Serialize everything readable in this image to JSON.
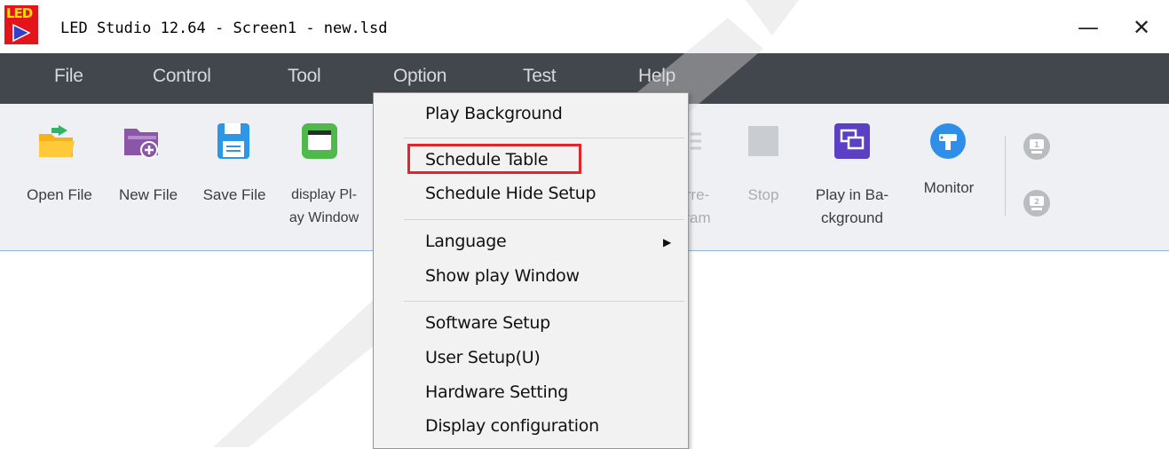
{
  "window": {
    "icon_text": "LED",
    "title": "LED Studio 12.64 - Screen1 - new.lsd",
    "minimize_glyph": "—",
    "close_glyph": "✕"
  },
  "menubar": {
    "items": [
      "File",
      "Control",
      "Tool",
      "Option",
      "Test",
      "Help"
    ]
  },
  "toolbar": {
    "buttons": [
      {
        "label": "Open File",
        "icon": "open-folder-icon"
      },
      {
        "label": "New File",
        "icon": "new-file-icon"
      },
      {
        "label": "Save File",
        "icon": "save-icon"
      },
      {
        "label": "display Pl-\nay Window",
        "icon": "play-window-icon"
      },
      {
        "label": "rre-\nram",
        "icon": "list-icon",
        "dim": true
      },
      {
        "label": "Stop",
        "icon": "stop-icon",
        "dim": true
      },
      {
        "label": "Play in Ba-\nckground",
        "icon": "play-background-icon"
      },
      {
        "label": "Monitor",
        "icon": "monitor-icon"
      },
      {
        "label": "",
        "icon": "screen-1-icon"
      },
      {
        "label": "",
        "icon": "screen-2-icon"
      }
    ]
  },
  "option_menu": {
    "items": [
      "Play Background",
      "Schedule Table",
      "Schedule Hide Setup",
      "Language",
      "Show play Window",
      "Software Setup",
      "User Setup(U)",
      "Hardware Setting",
      "Display configuration"
    ],
    "submenu_arrow": "▶"
  },
  "colors": {
    "menubar_bg": "#42464d",
    "toolbar_bg": "#eef0f3",
    "highlight": "#e4232b",
    "app_icon_bg": "#e4141b"
  }
}
